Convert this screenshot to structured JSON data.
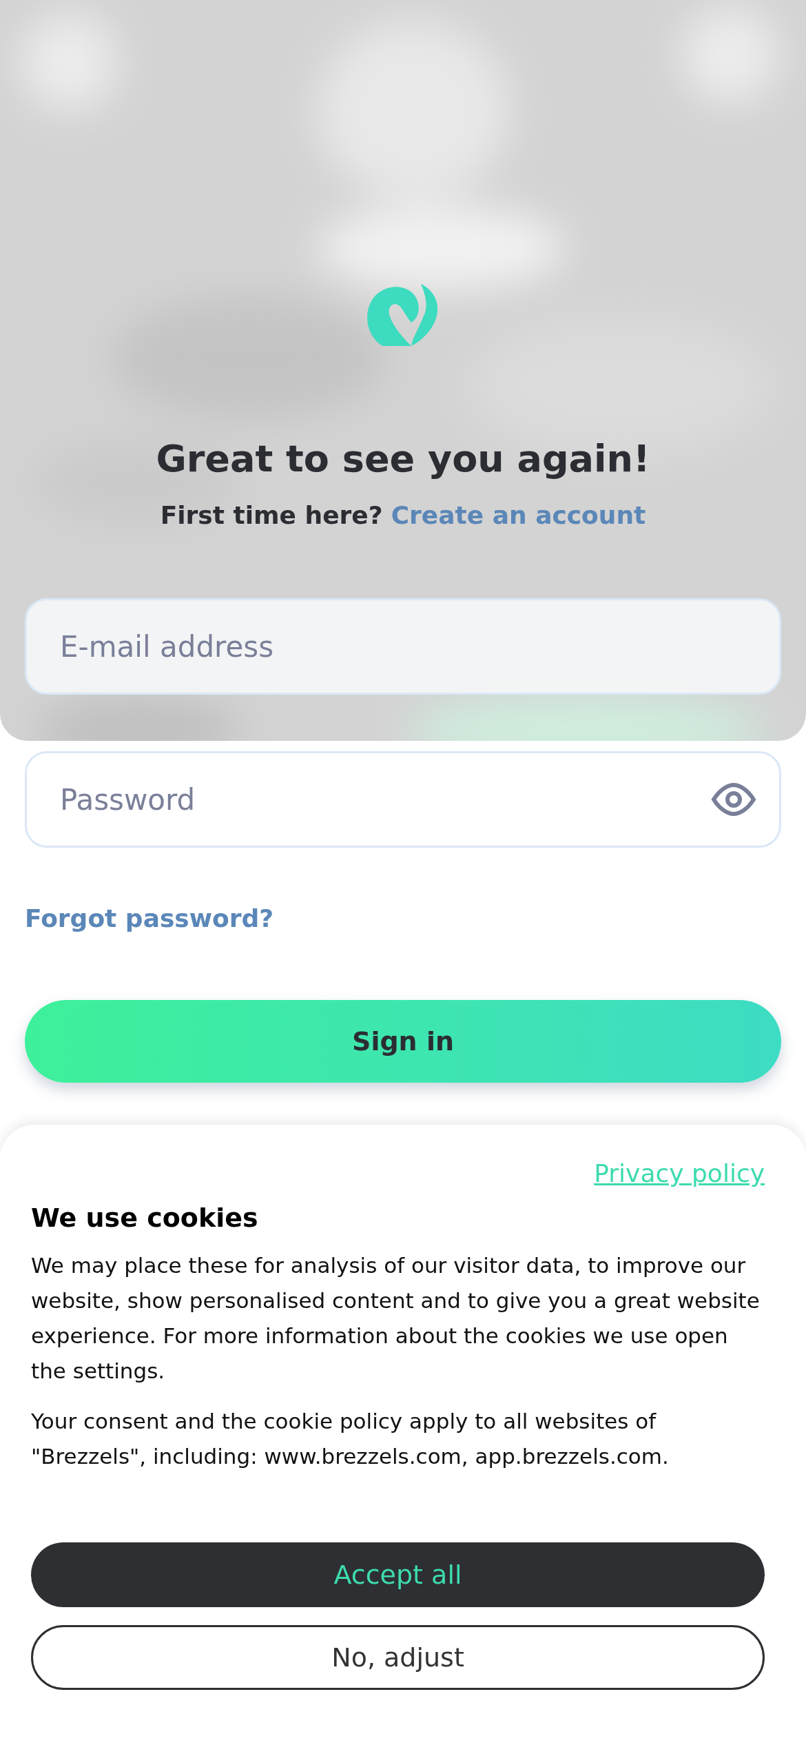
{
  "heading": "Great to see you again!",
  "signup_prompt": {
    "text": "First time here?",
    "link": "Create an account"
  },
  "email_field": {
    "placeholder": "E-mail address"
  },
  "password_field": {
    "placeholder": "Password"
  },
  "forgot_password": "Forgot password?",
  "sign_in_button": "Sign in",
  "cookie_banner": {
    "privacy_link": "Privacy policy",
    "title": "We use cookies",
    "paragraphs": [
      "We may place these for analysis of our visitor data, to improve our website, show personalised content and to give you a great website experience. For more information about the cookies we use open the settings.",
      "Your consent and the cookie policy apply to all websites of \"Brezzels\", including: www.brezzels.com, app.brezzels.com."
    ],
    "buttons": [
      {
        "label": "Accept all",
        "kind": "primary"
      },
      {
        "label": "No, adjust",
        "kind": "outline"
      }
    ]
  }
}
